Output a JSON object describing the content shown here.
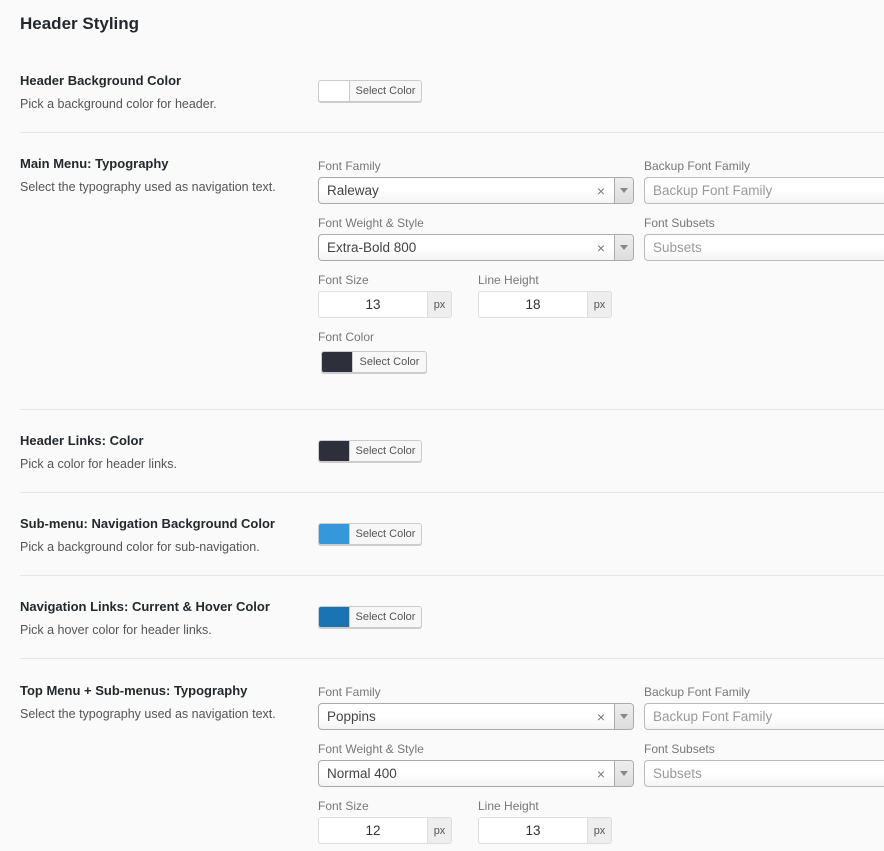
{
  "page_title": "Header Styling",
  "colors": {
    "white": "#ffffff",
    "dark": "#2d2f3a",
    "light_blue": "#3498db",
    "blue": "#1a73b2"
  },
  "select_color_label": "Select Color",
  "labels": {
    "font_family": "Font Family",
    "backup_font_family": "Backup Font Family",
    "font_weight_style": "Font Weight & Style",
    "font_subsets": "Font Subsets",
    "font_size": "Font Size",
    "line_height": "Line Height",
    "font_color": "Font Color",
    "px": "px",
    "clear": "×"
  },
  "placeholders": {
    "backup_font_family": "Backup Font Family",
    "subsets": "Subsets"
  },
  "options": {
    "header_bg": {
      "title": "Header Background Color",
      "desc": "Pick a background color for header."
    },
    "main_menu": {
      "title": "Main Menu: Typography",
      "desc": "Select the typography used as navigation text.",
      "font_family": "Raleway",
      "font_weight": "Extra-Bold 800",
      "font_size": "13",
      "line_height": "18"
    },
    "header_links": {
      "title": "Header Links: Color",
      "desc": "Pick a color for header links."
    },
    "submenu_bg": {
      "title": "Sub-menu: Navigation Background Color",
      "desc": "Pick a background color for sub-navigation."
    },
    "nav_links_hover": {
      "title": "Navigation Links: Current & Hover Color",
      "desc": "Pick a hover color for header links."
    },
    "top_menu": {
      "title": "Top Menu + Sub-menus: Typography",
      "desc": "Select the typography used as navigation text.",
      "font_family": "Poppins",
      "font_weight": "Normal 400",
      "font_size": "12",
      "line_height": "13"
    }
  }
}
